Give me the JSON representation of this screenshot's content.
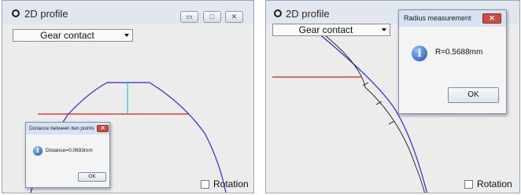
{
  "left_window": {
    "title": "2D profile",
    "combo_value": "Gear contact",
    "controls": {
      "minimize_glyph": "▭",
      "restore_glyph": "□",
      "close_glyph": "✕"
    },
    "rotation_label": "Rotation",
    "dialog": {
      "title": "Distance between two points",
      "message": "Distance=0.0693mm",
      "ok_label": "OK",
      "close_glyph": "✕",
      "icon_glyph": "i"
    }
  },
  "right_window": {
    "title": "2D profile",
    "combo_value": "Gear contact",
    "rotation_label": "Rotation",
    "dialog": {
      "title": "Radius measurement",
      "message": "R=0.5688mm",
      "ok_label": "OK",
      "close_glyph": "✕",
      "icon_glyph": "i"
    }
  },
  "colors": {
    "profile_line": "#2b2bd8",
    "reference_line": "#cc2020",
    "measure_line": "#20c6e0",
    "fit_curve": "#1a1a1a"
  }
}
